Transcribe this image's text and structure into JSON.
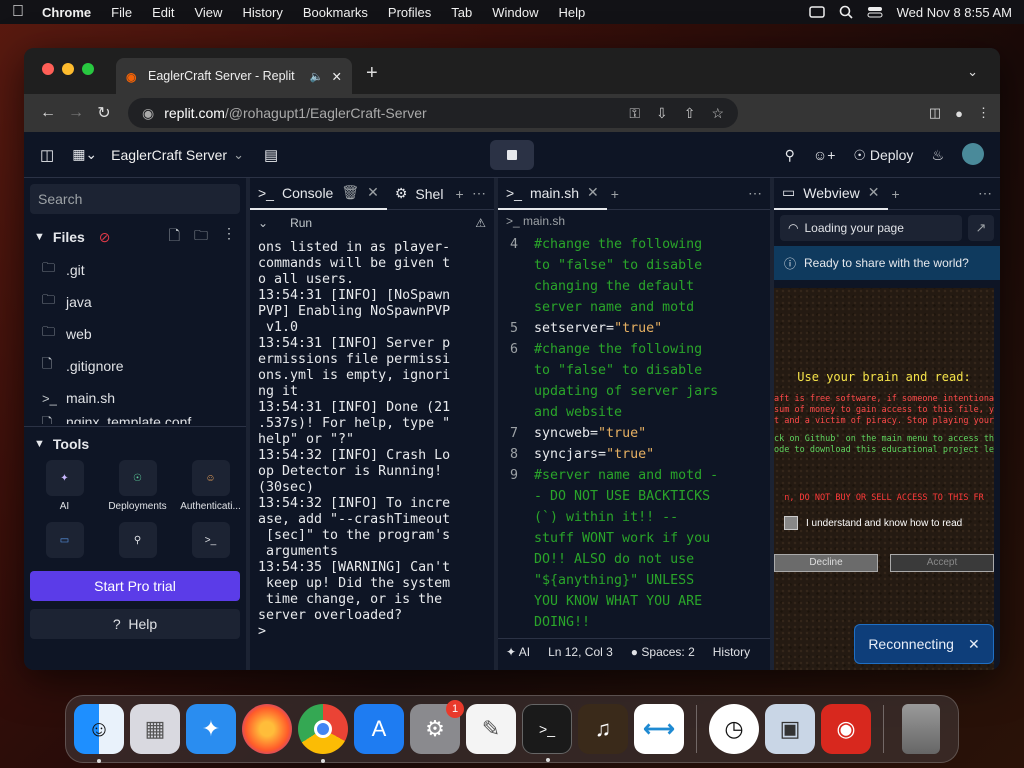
{
  "menubar": {
    "app": "Chrome",
    "items": [
      "File",
      "Edit",
      "View",
      "History",
      "Bookmarks",
      "Profiles",
      "Tab",
      "Window",
      "Help"
    ],
    "clock": "Wed Nov 8  8:55 AM"
  },
  "browser": {
    "tab_title": "EaglerCraft Server - Replit",
    "url_domain": "replit.com",
    "url_path": "/@rohagupt1/EaglerCraft-Server"
  },
  "replit": {
    "project": "EaglerCraft Server",
    "deploy": "Deploy",
    "search_placeholder": "Search",
    "files_label": "Files",
    "files": [
      ".git",
      "java",
      "web",
      ".gitignore",
      "main.sh",
      "nginx_template.conf"
    ],
    "tools_label": "Tools",
    "tools": [
      {
        "label": "AI",
        "icon": "ai-icon"
      },
      {
        "label": "Deployments",
        "icon": "deployments-icon"
      },
      {
        "label": "Authenticati...",
        "icon": "user-icon"
      },
      {
        "label": "",
        "icon": "chat-icon"
      },
      {
        "label": "",
        "icon": "search-icon"
      },
      {
        "label": "",
        "icon": "shell-icon"
      }
    ],
    "pro_trial": "Start Pro trial",
    "help": "Help"
  },
  "console": {
    "tab_console": "Console",
    "tab_shell": "Shel",
    "run_label": "Run",
    "output": "ons listed in as player-\ncommands will be given t\no all users.\n13:54:31 [INFO] [NoSpawn\nPVP] Enabling NoSpawnPVP\n v1.0\n13:54:31 [INFO] Server p\nermissions file permissi\nons.yml is empty, ignori\nng it\n13:54:31 [INFO] Done (21\n.537s)! For help, type \"\nhelp\" or \"?\"\n13:54:32 [INFO] Crash Lo\nop Detector is Running!\n(30sec)\n13:54:32 [INFO] To incre\nase, add \"--crashTimeout\n [sec]\" to the program's\n arguments\n13:54:35 [WARNING] Can't\n keep up! Did the system\n time change, or is the\nserver overloaded?\n>"
  },
  "editor": {
    "tab": "main.sh",
    "crumb": "main.sh",
    "lines": [
      {
        "n": "4",
        "type": "comment",
        "text": "#change the following\nto \"false\" to disable\nchanging the default\nserver name and motd"
      },
      {
        "n": "5",
        "type": "assign",
        "key": "setserver=",
        "val": "\"true\""
      },
      {
        "n": "6",
        "type": "comment",
        "text": "#change the following\nto \"false\" to disable\nupdating of server jars\nand website"
      },
      {
        "n": "7",
        "type": "assign",
        "key": "syncweb=",
        "val": "\"true\""
      },
      {
        "n": "8",
        "type": "assign",
        "key": "syncjars=",
        "val": "\"true\""
      },
      {
        "n": "9",
        "type": "comment",
        "text": "#server name and motd -\n- DO NOT USE BACKTICKS\n(`) within it!! --\nstuff WONT work if you\nDO!! ALSO do not use\n\"${anything}\" UNLESS\nYOU KNOW WHAT YOU ARE\nDOING!!"
      }
    ],
    "status_ai": "AI",
    "status_pos": "Ln 12, Col 3",
    "status_spaces": "Spaces: 2",
    "status_history": "History"
  },
  "webview": {
    "tab": "Webview",
    "loading": "Loading your page",
    "share": "Ready to share with the world?",
    "game": {
      "heading": "Use your brain and read:",
      "line1": "aft is free software, if someone intentionally",
      "line2": "sum of money to gain access to this file, yo",
      "line3": "t and a victim of piracy. Stop playing yours",
      "line4": "ck on Github' on the main menu to access th",
      "line5": "ode to download this educational project le",
      "line6": "n, DO NOT BUY OR SELL ACCESS TO THIS FR",
      "checkbox": "I understand and know how to read",
      "decline": "Decline",
      "accept": "Accept"
    },
    "reconnecting": "Reconnecting"
  },
  "dock": {
    "apps": [
      "Finder",
      "Launchpad",
      "Safari",
      "Firefox",
      "Chrome",
      "App Store",
      "System Settings",
      "TextEdit",
      "Terminal",
      "Instruments",
      "VS Code",
      "Clock",
      "Preview",
      "Photo Booth",
      "Trash"
    ],
    "settings_badge": "1"
  },
  "colors": {
    "accent": "#5b3ce8",
    "comment": "#2aa52a",
    "string": "#e6b062",
    "replit_bg": "#0e1525"
  }
}
